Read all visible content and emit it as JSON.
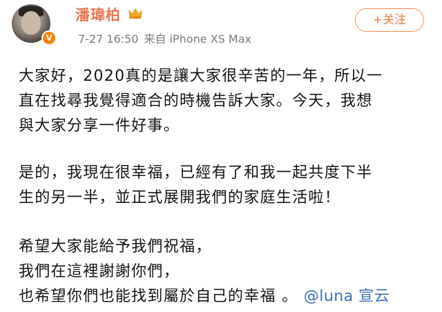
{
  "user": {
    "name": "潘瑋柏",
    "timestamp": "7-27 16:50",
    "source": "来自 iPhone XS Max",
    "crown_icon": "crown-icon",
    "verified_icon": "verified-v-icon"
  },
  "follow_button": {
    "label": "+关注"
  },
  "post": {
    "lines": [
      "大家好，2020真的是讓大家很辛苦的一年，所以一",
      "直在找尋我覺得適合的時機告訴大家。今天，我想",
      "與大家分享一件好事。",
      "是的，我現在很幸福，已經有了和我一起共度下半",
      "生的另一半，並正式展開我們的家庭生活啦！",
      "希望大家能給予我們祝福，",
      "我們在這裡謝謝你們，",
      "也希望你們也能找到屬於自己的幸福 。"
    ],
    "watermark": "@luna 宣云"
  },
  "colors": {
    "username": "#eb7350",
    "follow": "#f07a3a",
    "meta": "#7a7a7a",
    "watermark": "#3d6fb8"
  }
}
